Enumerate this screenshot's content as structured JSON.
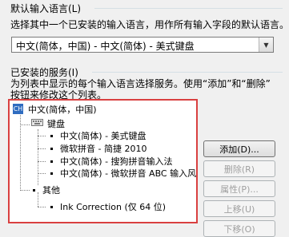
{
  "default_language": {
    "heading": "默认输入语言(L)",
    "description": "选择其中一个已安装的输入语言，用作所有输入字段的默认语言。",
    "selected": "中文(简体，中国) - 中文(简体) - 美式键盘"
  },
  "installed_services": {
    "heading": "已安装的服务(I)",
    "description_line1": "为列表中显示的每个输入语言选择服务。使用“添加”和“删除”",
    "description_line2": "按钮来修改这个列表。",
    "tree": {
      "language": "中文(简体，中国)",
      "language_badge": "CH",
      "keyboard_group": "键盘",
      "keyboards": [
        "中文(简体) - 美式键盘",
        "微软拼音 - 简捷 2010",
        "中文(简体) - 搜狗拼音输入法",
        "中文(简体) - 微软拼音 ABC 输入风格"
      ],
      "other_group": "其他",
      "other_items": [
        "Ink Correction (仅 64 位)"
      ]
    }
  },
  "buttons": {
    "add": "添加(D)...",
    "remove": "删除(R)",
    "properties": "属性(P)...",
    "move_up": "上移(U)",
    "move_down": "下移(O)"
  }
}
